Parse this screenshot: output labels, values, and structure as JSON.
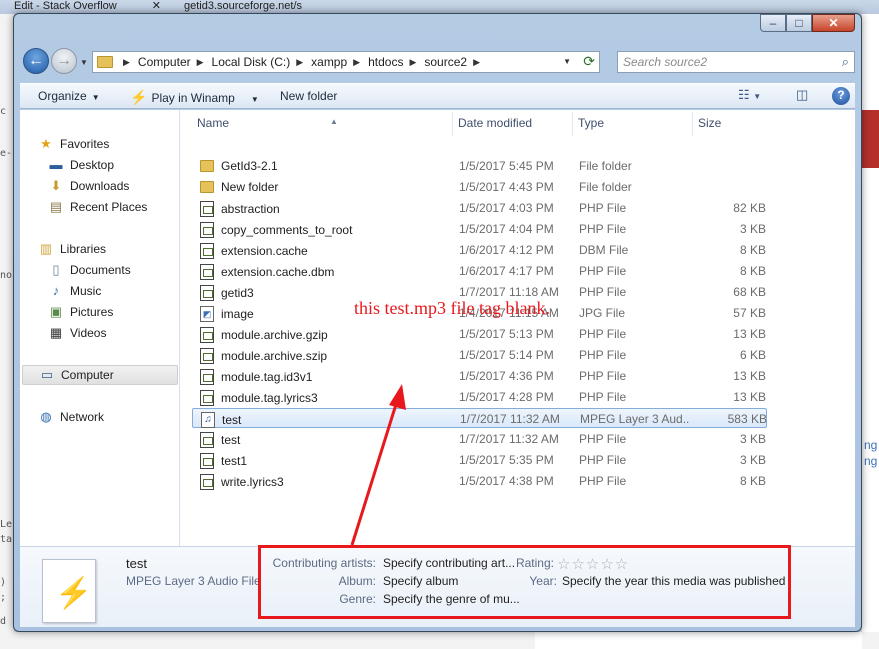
{
  "background": {
    "tabs": [
      {
        "label": "Edit - Stack Overflow"
      },
      {
        "label": "getid3.sourceforge.net/s"
      }
    ],
    "side_links": [
      "ng",
      "ng"
    ]
  },
  "window": {
    "caption_buttons": {
      "minimize": "–",
      "maximize": "□",
      "close": "✕"
    }
  },
  "address": {
    "crumbs": [
      "Computer",
      "Local Disk (C:)",
      "xampp",
      "htdocs",
      "source2"
    ],
    "search_placeholder": "Search source2"
  },
  "toolbar": {
    "organize": "Organize",
    "play": "Play in Winamp",
    "new_folder": "New folder"
  },
  "nav": {
    "favorites": "Favorites",
    "favorites_items": [
      "Desktop",
      "Downloads",
      "Recent Places"
    ],
    "libraries": "Libraries",
    "libraries_items": [
      "Documents",
      "Music",
      "Pictures",
      "Videos"
    ],
    "computer": "Computer",
    "network": "Network"
  },
  "columns": {
    "name": "Name",
    "date": "Date modified",
    "type": "Type",
    "size": "Size"
  },
  "files": [
    {
      "name": "GetId3-2.1",
      "date": "1/5/2017 5:45 PM",
      "type": "File folder",
      "size": "",
      "icon": "folder"
    },
    {
      "name": "New folder",
      "date": "1/5/2017 4:43 PM",
      "type": "File folder",
      "size": "",
      "icon": "folder"
    },
    {
      "name": "abstraction",
      "date": "1/5/2017 4:03 PM",
      "type": "PHP File",
      "size": "82 KB",
      "icon": "php"
    },
    {
      "name": "copy_comments_to_root",
      "date": "1/5/2017 4:04 PM",
      "type": "PHP File",
      "size": "3 KB",
      "icon": "php"
    },
    {
      "name": "extension.cache",
      "date": "1/6/2017 4:12 PM",
      "type": "DBM File",
      "size": "8 KB",
      "icon": "php"
    },
    {
      "name": "extension.cache.dbm",
      "date": "1/6/2017 4:17 PM",
      "type": "PHP File",
      "size": "8 KB",
      "icon": "php"
    },
    {
      "name": "getid3",
      "date": "1/7/2017 11:18 AM",
      "type": "PHP File",
      "size": "68 KB",
      "icon": "php"
    },
    {
      "name": "image",
      "date": "1/4/2017 11:15 AM",
      "type": "JPG File",
      "size": "57 KB",
      "icon": "jpg"
    },
    {
      "name": "module.archive.gzip",
      "date": "1/5/2017 5:13 PM",
      "type": "PHP File",
      "size": "13 KB",
      "icon": "php"
    },
    {
      "name": "module.archive.szip",
      "date": "1/5/2017 5:14 PM",
      "type": "PHP File",
      "size": "6 KB",
      "icon": "php"
    },
    {
      "name": "module.tag.id3v1",
      "date": "1/5/2017 4:36 PM",
      "type": "PHP File",
      "size": "13 KB",
      "icon": "php"
    },
    {
      "name": "module.tag.lyrics3",
      "date": "1/5/2017 4:28 PM",
      "type": "PHP File",
      "size": "13 KB",
      "icon": "php"
    },
    {
      "name": "test",
      "date": "1/7/2017 11:32 AM",
      "type": "MPEG Layer 3 Aud...",
      "size": "583 KB",
      "icon": "mp3",
      "selected": true
    },
    {
      "name": "test",
      "date": "1/7/2017 11:32 AM",
      "type": "PHP File",
      "size": "3 KB",
      "icon": "php"
    },
    {
      "name": "test1",
      "date": "1/5/2017 5:35 PM",
      "type": "PHP File",
      "size": "3 KB",
      "icon": "php"
    },
    {
      "name": "write.lyrics3",
      "date": "1/5/2017 4:38 PM",
      "type": "PHP File",
      "size": "8 KB",
      "icon": "php"
    }
  ],
  "annotation": "this  test.mp3 file tag blank.",
  "details": {
    "title": "test",
    "subtitle": "MPEG Layer 3 Audio File",
    "contributing_label": "Contributing artists:",
    "contributing_value": "Specify contributing art...",
    "album_label": "Album:",
    "album_value": "Specify album",
    "genre_label": "Genre:",
    "genre_value": "Specify the genre of mu...",
    "rating_label": "Rating:",
    "rating_stars": "☆☆☆☆☆",
    "year_label": "Year:",
    "year_value": "Specify the year this media was published"
  },
  "colors": {
    "annotation": "#e8181c",
    "selection": "#d9e8fa"
  }
}
